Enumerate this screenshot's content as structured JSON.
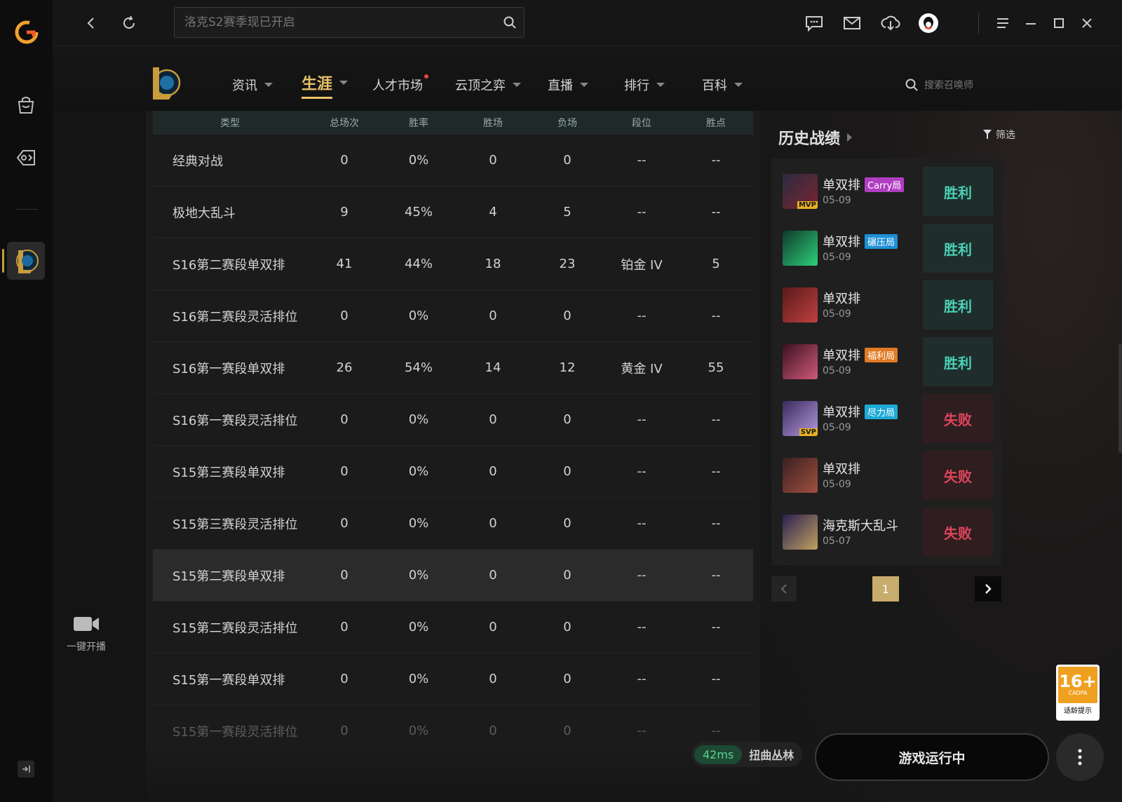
{
  "titlebar": {
    "search_placeholder": "洛克S2赛季现已开启"
  },
  "nav": {
    "items": [
      {
        "label": "资讯",
        "caret": true
      },
      {
        "label": "生涯",
        "caret": true,
        "active": true
      },
      {
        "label": "人才市场",
        "dot": true
      },
      {
        "label": "云顶之弈",
        "caret": true
      },
      {
        "label": "直播",
        "caret": true
      },
      {
        "label": "排行",
        "caret": true
      },
      {
        "label": "百科",
        "caret": true
      }
    ],
    "summoner_search_placeholder": "搜索召唤师"
  },
  "stats_table": {
    "headers": [
      "类型",
      "总场次",
      "胜率",
      "胜场",
      "负场",
      "段位",
      "胜点"
    ],
    "rows": [
      [
        "经典对战",
        "0",
        "0%",
        "0",
        "0",
        "--",
        "--"
      ],
      [
        "极地大乱斗",
        "9",
        "45%",
        "4",
        "5",
        "--",
        "--"
      ],
      [
        "S16第二赛段单双排",
        "41",
        "44%",
        "18",
        "23",
        "铂金 IV",
        "5"
      ],
      [
        "S16第二赛段灵活排位",
        "0",
        "0%",
        "0",
        "0",
        "--",
        "--"
      ],
      [
        "S16第一赛段单双排",
        "26",
        "54%",
        "14",
        "12",
        "黄金 IV",
        "55"
      ],
      [
        "S16第一赛段灵活排位",
        "0",
        "0%",
        "0",
        "0",
        "--",
        "--"
      ],
      [
        "S15第三赛段单双排",
        "0",
        "0%",
        "0",
        "0",
        "--",
        "--"
      ],
      [
        "S15第三赛段灵活排位",
        "0",
        "0%",
        "0",
        "0",
        "--",
        "--"
      ],
      [
        "S15第二赛段单双排",
        "0",
        "0%",
        "0",
        "0",
        "--",
        "--"
      ],
      [
        "S15第二赛段灵活排位",
        "0",
        "0%",
        "0",
        "0",
        "--",
        "--"
      ],
      [
        "S15第一赛段单双排",
        "0",
        "0%",
        "0",
        "0",
        "--",
        "--"
      ],
      [
        "S15第一赛段灵活排位",
        "0",
        "0%",
        "0",
        "0",
        "--",
        "--"
      ]
    ],
    "highlighted_row": 8
  },
  "history": {
    "title": "历史战绩",
    "filter_label": "筛选",
    "matches": [
      {
        "mode": "单双排",
        "tag": "Carry局",
        "tag_color": "#b03ec0",
        "date": "05-09",
        "badge": "MVP",
        "result": "胜利",
        "win": true,
        "avatar_colors": [
          "#2b2b40",
          "#7a2530"
        ]
      },
      {
        "mode": "单双排",
        "tag": "碾压局",
        "tag_color": "#1e8fd6",
        "date": "05-09",
        "badge": "",
        "result": "胜利",
        "win": true,
        "avatar_colors": [
          "#0d3a2a",
          "#2fd07a"
        ]
      },
      {
        "mode": "单双排",
        "tag": "",
        "tag_color": "",
        "date": "05-09",
        "badge": "",
        "result": "胜利",
        "win": true,
        "avatar_colors": [
          "#5a1a1a",
          "#c04040"
        ]
      },
      {
        "mode": "单双排",
        "tag": "福利局",
        "tag_color": "#e07a24",
        "date": "05-09",
        "badge": "",
        "result": "胜利",
        "win": true,
        "avatar_colors": [
          "#3a1020",
          "#d05a7a"
        ]
      },
      {
        "mode": "单双排",
        "tag": "尽力局",
        "tag_color": "#1eaad6",
        "date": "05-09",
        "badge": "SVP",
        "result": "失败",
        "win": false,
        "avatar_colors": [
          "#3a2a5a",
          "#b49ae0"
        ]
      },
      {
        "mode": "单双排",
        "tag": "",
        "tag_color": "",
        "date": "05-09",
        "badge": "",
        "result": "失败",
        "win": false,
        "avatar_colors": [
          "#3a2020",
          "#a05040"
        ]
      },
      {
        "mode": "海克斯大乱斗",
        "tag": "",
        "tag_color": "",
        "date": "05-07",
        "badge": "",
        "result": "失败",
        "win": false,
        "avatar_colors": [
          "#2a2050",
          "#c0a060"
        ]
      }
    ],
    "page": "1"
  },
  "live": {
    "label": "一键开播"
  },
  "status": {
    "ping": "42ms",
    "server": "扭曲丛林",
    "run_label": "游戏运行中"
  },
  "age_rating": {
    "age": "16+",
    "org": "CADPA",
    "tip": "适龄提示"
  },
  "colors": {
    "accent_gold": "#e8c36a",
    "win": "#4bd0b7",
    "lose": "#e0455a"
  }
}
